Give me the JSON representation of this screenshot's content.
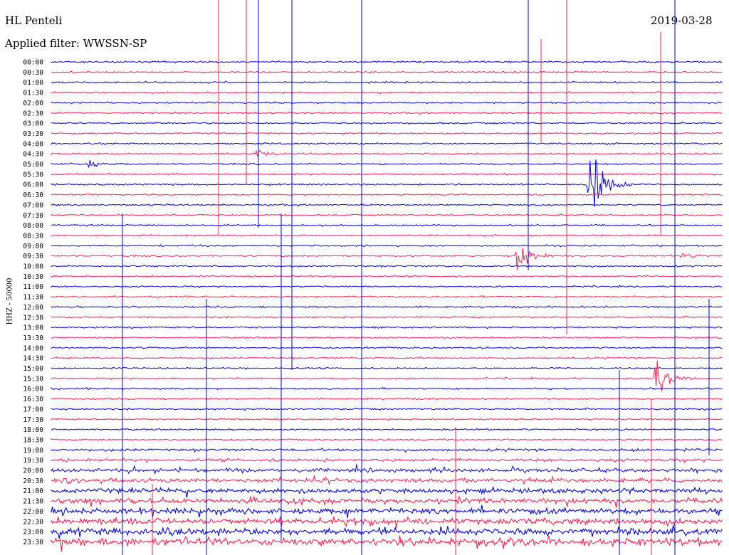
{
  "header": {
    "station": "HL Penteli",
    "filter": "Applied filter: WWSSN-SP",
    "date": "2019-03-28"
  },
  "chart_data": {
    "type": "line",
    "title": "HL Penteli",
    "ylabel": "HHZ - 50000",
    "colors": [
      "#0000e0",
      "#ff1f4e"
    ],
    "rows": [
      "00:00",
      "00:30",
      "01:00",
      "01:30",
      "02:00",
      "02:30",
      "03:00",
      "03:30",
      "04:00",
      "04:30",
      "05:00",
      "05:30",
      "06:00",
      "06:30",
      "07:00",
      "07:30",
      "08:00",
      "08:30",
      "09:00",
      "09:30",
      "10:00",
      "10:30",
      "11:00",
      "11:30",
      "12:00",
      "12:30",
      "13:00",
      "13:30",
      "14:00",
      "14:30",
      "15:00",
      "15:30",
      "16:00",
      "16:30",
      "17:00",
      "17:30",
      "18:00",
      "18:30",
      "19:00",
      "19:30",
      "20:00",
      "20:30",
      "21:00",
      "21:30",
      "22:00",
      "22:30",
      "23:00",
      "23:30"
    ],
    "events": [
      {
        "row": 9,
        "minute": 9.1,
        "amplitude": 12
      },
      {
        "row": 10,
        "minute": 1.6,
        "amplitude": 11
      },
      {
        "row": 12,
        "minute": 24.0,
        "amplitude": 150
      },
      {
        "row": 19,
        "minute": 20.8,
        "amplitude": 62
      },
      {
        "row": 19,
        "minute": 28.1,
        "amplitude": 14
      },
      {
        "row": 31,
        "minute": 27.0,
        "amplitude": 60
      }
    ]
  }
}
